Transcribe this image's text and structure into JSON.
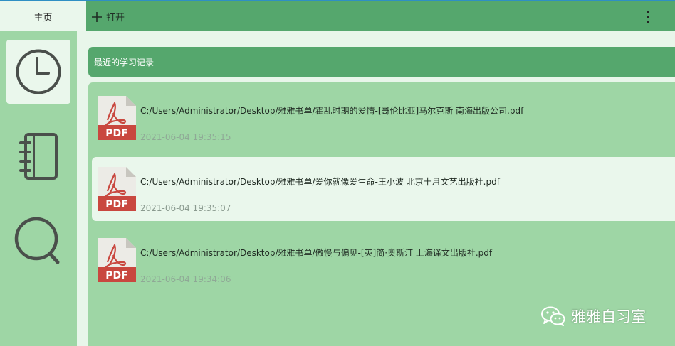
{
  "header": {
    "tab_home": "主页",
    "open_label": "打开",
    "more_icon": "more-vertical-icon"
  },
  "sidebar": {
    "items": [
      {
        "name": "history",
        "icon": "clock-icon",
        "active": true
      },
      {
        "name": "notebook",
        "icon": "notebook-icon",
        "active": false
      },
      {
        "name": "search",
        "icon": "search-icon",
        "active": false
      }
    ]
  },
  "main": {
    "section_title": "最近的学习记录",
    "files": [
      {
        "path": "C:/Users/Administrator/Desktop/雅雅书单/霍乱时期的爱情-[哥伦比亚]马尔克斯  南海出版公司.pdf",
        "time": "2021-06-04 19:35:15",
        "icon_label": "PDF",
        "selected": false
      },
      {
        "path": "C:/Users/Administrator/Desktop/雅雅书单/爱你就像爱生命-王小波 北京十月文艺出版社.pdf",
        "time": "2021-06-04 19:35:07",
        "icon_label": "PDF",
        "selected": true
      },
      {
        "path": "C:/Users/Administrator/Desktop/雅雅书单/傲慢与偏见-[英]简·奥斯汀 上海译文出版社.pdf",
        "time": "2021-06-04 19:34:06",
        "icon_label": "PDF",
        "selected": false
      }
    ]
  },
  "watermark": {
    "text": "雅雅自习室",
    "icon": "wechat-icon"
  },
  "colors": {
    "topbar": "#55a76d",
    "sidebar": "#9ed6a5",
    "panel": "#9ed6a5",
    "highlight": "#eaf7ec",
    "pdf_red": "#c9473f",
    "icon_stroke": "#4a4f4b"
  }
}
